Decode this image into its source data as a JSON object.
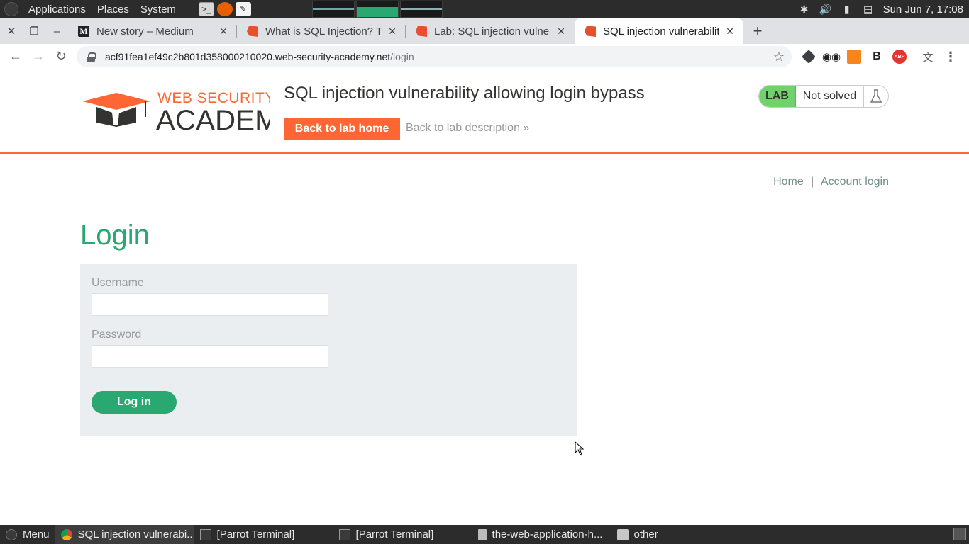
{
  "system_panel": {
    "menus": [
      "Applications",
      "Places",
      "System"
    ],
    "clock": "Sun Jun 7, 17:08"
  },
  "browser": {
    "tabs": [
      {
        "title": "New story – Medium",
        "favicon": "medium-icon"
      },
      {
        "title": "What is SQL Injection? Tut",
        "favicon": "portswigger-icon"
      },
      {
        "title": "Lab: SQL injection vulnera",
        "favicon": "portswigger-icon"
      },
      {
        "title": "SQL injection vulnerability",
        "favicon": "portswigger-icon",
        "active": true
      }
    ],
    "url_host": "acf91fea1ef49c2b801d358000210020.web-security-academy.net",
    "url_path": "/login"
  },
  "lab_header": {
    "logo_top": "WEB SECURITY",
    "logo_bottom": "ACADEMY",
    "title": "SQL injection vulnerability allowing login bypass",
    "back_home_label": "Back to lab home",
    "back_desc_label": "Back to lab description »",
    "badge": "LAB",
    "status": "Not solved"
  },
  "nav": {
    "home": "Home",
    "separator": "|",
    "account": "Account login"
  },
  "login": {
    "heading": "Login",
    "username_label": "Username",
    "username_value": "",
    "password_label": "Password",
    "password_value": "",
    "submit": "Log in"
  },
  "taskbar": {
    "menu": "Menu",
    "items": [
      {
        "label": "SQL injection vulnerabi...",
        "icon": "chrome-icon",
        "active": true
      },
      {
        "label": "[Parrot Terminal]",
        "icon": "terminal-icon"
      },
      {
        "label": "[Parrot Terminal]",
        "icon": "terminal-icon"
      },
      {
        "label": "the-web-application-h...",
        "icon": "file-icon"
      },
      {
        "label": "other",
        "icon": "folder-icon"
      }
    ]
  },
  "colors": {
    "accent_orange": "#ff6633",
    "accent_green": "#2aa872",
    "lab_badge": "#70d16d"
  }
}
